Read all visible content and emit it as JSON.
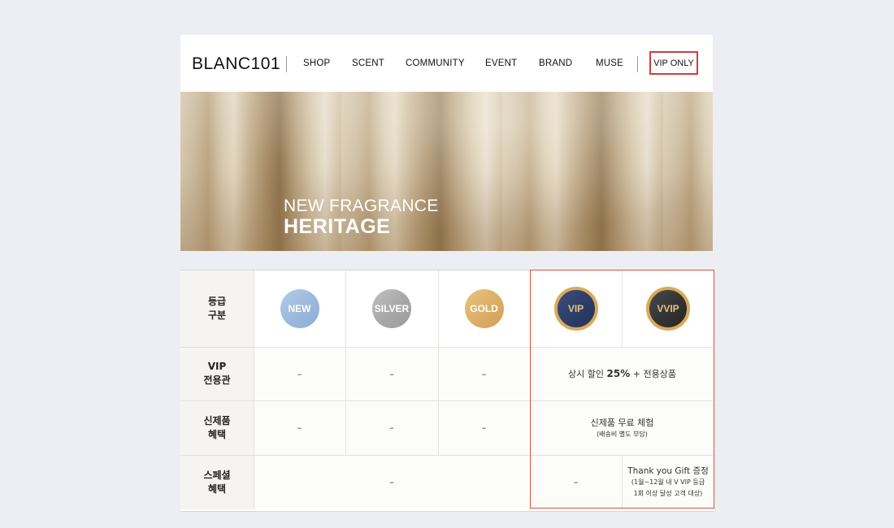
{
  "nav": {
    "logo": "BLANC101",
    "items": [
      "SHOP",
      "SCENT",
      "COMMUNITY",
      "EVENT",
      "BRAND",
      "MUSE"
    ],
    "vip_button": "VIP ONLY"
  },
  "banner": {
    "subtitle": "NEW FRAGRANCE",
    "title": "HERITAGE"
  },
  "table": {
    "header_label_line1": "등급",
    "header_label_line2": "구분",
    "tiers": [
      "NEW",
      "SILVER",
      "GOLD",
      "VIP",
      "VVIP"
    ],
    "rows": [
      {
        "label_line1": "VIP",
        "label_line2": "전용관",
        "cells": [
          "–",
          "–",
          "–"
        ],
        "merged_pre": "상시 할인 ",
        "merged_bold": "25%",
        "merged_post": " + 전용상품"
      },
      {
        "label_line1": "신제품",
        "label_line2": "혜택",
        "cells": [
          "–",
          "–",
          "–"
        ],
        "merged_main": "신제품 무료 체험",
        "merged_sub": "(배송비 별도 부담)"
      },
      {
        "label_line1": "스페셜",
        "label_line2": "혜택",
        "merged_left": "–",
        "vip_cell": "–",
        "vvip_main": "Thank you Gift 증정",
        "vvip_sub1": "(1월~12월 내 V VIP 등급",
        "vvip_sub2": "1회 이상 달성 고객 대상)"
      }
    ]
  }
}
